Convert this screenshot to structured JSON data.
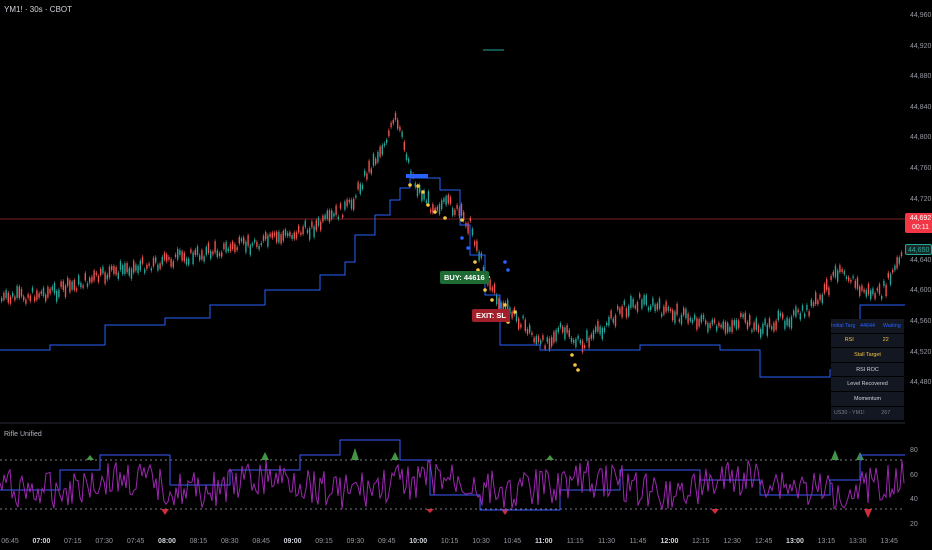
{
  "header": {
    "title": "YM1! · 30s · CBOT"
  },
  "price_axis": [
    "44,960",
    "44,920",
    "44,880",
    "44,840",
    "44,800",
    "44,760",
    "44,720",
    "44,680",
    "44,640",
    "44,600",
    "44,560",
    "44,520",
    "44,480"
  ],
  "current_price": {
    "price": "44,692",
    "countdown": "00:11"
  },
  "last_price_tag": "44,650",
  "trade": {
    "buy_label": "BUY: 44616",
    "exit_label": "EXIT: SL"
  },
  "status_table": {
    "rows": [
      {
        "cells": [
          "Initial Target",
          "44644",
          "Waiting"
        ],
        "colors": [
          "#2962ff",
          "#2962ff",
          "#2962ff"
        ]
      },
      {
        "cells": [
          "RSI",
          "22"
        ],
        "colors": [
          "#f5c542",
          "#f5c542"
        ]
      },
      {
        "cells": [
          "Stall Target"
        ],
        "colors": [
          "#f5c542"
        ]
      },
      {
        "cells": [
          "RSI ROC"
        ],
        "colors": [
          "#d1d4dc"
        ]
      },
      {
        "cells": [
          "Level Recovered"
        ],
        "colors": [
          "#d1d4dc"
        ]
      },
      {
        "cells": [
          "Momentum"
        ],
        "colors": [
          "#d1d4dc"
        ]
      },
      {
        "cells": [
          "US30 - YM1!",
          "267"
        ],
        "colors": [
          "#787b86",
          "#787b86"
        ]
      }
    ]
  },
  "indicator": {
    "title": "Rifle Unified",
    "axis": [
      "80",
      "60",
      "40",
      "20"
    ]
  },
  "time_axis": [
    {
      "t": "06:45",
      "b": false
    },
    {
      "t": "07:00",
      "b": true
    },
    {
      "t": "07:15",
      "b": false
    },
    {
      "t": "07:30",
      "b": false
    },
    {
      "t": "07:45",
      "b": false
    },
    {
      "t": "08:00",
      "b": true
    },
    {
      "t": "08:15",
      "b": false
    },
    {
      "t": "08:30",
      "b": false
    },
    {
      "t": "08:45",
      "b": false
    },
    {
      "t": "09:00",
      "b": true
    },
    {
      "t": "09:15",
      "b": false
    },
    {
      "t": "09:30",
      "b": false
    },
    {
      "t": "09:45",
      "b": false
    },
    {
      "t": "10:00",
      "b": true
    },
    {
      "t": "10:15",
      "b": false
    },
    {
      "t": "10:30",
      "b": false
    },
    {
      "t": "10:45",
      "b": false
    },
    {
      "t": "11:00",
      "b": true
    },
    {
      "t": "11:15",
      "b": false
    },
    {
      "t": "11:30",
      "b": false
    },
    {
      "t": "11:45",
      "b": false
    },
    {
      "t": "12:00",
      "b": true
    },
    {
      "t": "12:15",
      "b": false
    },
    {
      "t": "12:30",
      "b": false
    },
    {
      "t": "12:45",
      "b": false
    },
    {
      "t": "13:00",
      "b": true
    },
    {
      "t": "13:15",
      "b": false
    },
    {
      "t": "13:30",
      "b": false
    },
    {
      "t": "13:45",
      "b": false
    }
  ],
  "colors": {
    "up": "#26a69a",
    "down": "#ef5350",
    "line": "#2962ff",
    "rsi": "#9c27b0",
    "marker": "#f5c542",
    "current_line": "#f23645"
  }
}
